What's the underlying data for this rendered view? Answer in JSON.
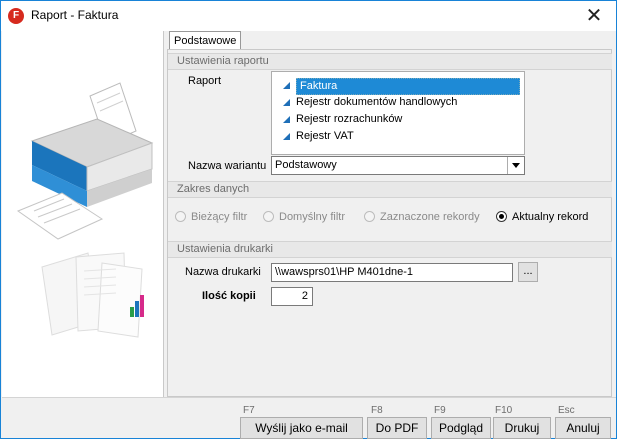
{
  "window": {
    "title": "Raport - Faktura",
    "app_icon": "F",
    "close_glyph": "✕"
  },
  "tabs": [
    {
      "label": "Podstawowe",
      "active": true
    }
  ],
  "sections": {
    "report_settings": "Ustawienia raportu",
    "data_range": "Zakres danych",
    "printer_settings": "Ustawienia drukarki"
  },
  "report": {
    "label": "Raport",
    "items": [
      {
        "label": "Faktura",
        "selected": true
      },
      {
        "label": "Rejestr dokumentów handlowych",
        "selected": false
      },
      {
        "label": "Rejestr rozrachunków",
        "selected": false
      },
      {
        "label": "Rejestr VAT",
        "selected": false
      }
    ]
  },
  "variant": {
    "label": "Nazwa wariantu",
    "value": "Podstawowy"
  },
  "range_options": [
    {
      "label": "Bieżący filtr",
      "checked": false,
      "enabled": false
    },
    {
      "label": "Domyślny filtr",
      "checked": false,
      "enabled": false
    },
    {
      "label": "Zaznaczone rekordy",
      "checked": false,
      "enabled": false
    },
    {
      "label": "Aktualny rekord",
      "checked": true,
      "enabled": true
    }
  ],
  "printer": {
    "name_label": "Nazwa drukarki",
    "name_value": "\\\\wawsprs01\\HP M401dne-1",
    "browse_label": "...",
    "copies_label": "Ilość kopii",
    "copies_value": "2"
  },
  "buttons": [
    {
      "label": "Wyślij jako e-mail",
      "key": "F7"
    },
    {
      "label": "Do PDF",
      "key": "F8"
    },
    {
      "label": "Podgląd",
      "key": "F9"
    },
    {
      "label": "Drukuj",
      "key": "F10"
    },
    {
      "label": "Anuluj",
      "key": "Esc"
    }
  ],
  "colors": {
    "accent": "#1e8ad6",
    "printer_blue": "#1b75bc",
    "app_icon": "#d62a1e"
  }
}
